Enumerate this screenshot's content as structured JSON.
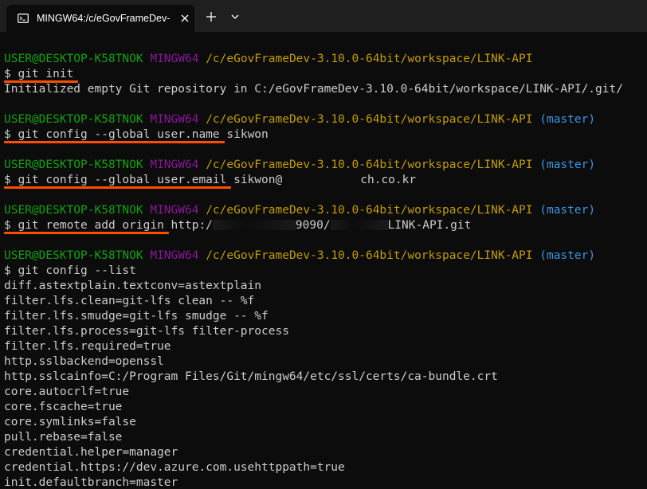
{
  "tab": {
    "title": "MINGW64:/c/eGovFrameDev-",
    "icon": "terminal-icon",
    "close_icon": "close-icon",
    "new_tab_icon": "plus-icon",
    "dropdown_icon": "chevron-down-icon"
  },
  "colors": {
    "user": "#13a10e",
    "shell": "#881798",
    "path": "#c19c00",
    "branch": "#3a96dd",
    "text": "#cccccc",
    "underline": "#ff4e00",
    "background": "#0c0c0c"
  },
  "prompt": {
    "user": "USER@DESKTOP-K58TNOK",
    "shell": "MINGW64",
    "path": "/c/eGovFrameDev-3.10.0-64bit/workspace/LINK-API",
    "branch": "(master)",
    "symbol": "$"
  },
  "commands": {
    "init": "git init",
    "init_output": "Initialized empty Git repository in C:/eGovFrameDev-3.10.0-64bit/workspace/LINK-API/.git/",
    "config_name": "git config --global user.name",
    "config_name_value": "sikwon",
    "config_email": "git config --global user.email",
    "config_email_prefix": "sikwon@",
    "config_email_suffix": "ch.co.kr",
    "remote_add": "git remote add origin",
    "remote_url_prefix": "http:/",
    "remote_url_mid": "9090/",
    "remote_url_suffix": "LINK-API.git",
    "config_list": "git config --list"
  },
  "config_list_output": [
    "diff.astextplain.textconv=astextplain",
    "filter.lfs.clean=git-lfs clean -- %f",
    "filter.lfs.smudge=git-lfs smudge -- %f",
    "filter.lfs.process=git-lfs filter-process",
    "filter.lfs.required=true",
    "http.sslbackend=openssl",
    "http.sslcainfo=C:/Program Files/Git/mingw64/etc/ssl/certs/ca-bundle.crt",
    "core.autocrlf=true",
    "core.fscache=true",
    "core.symlinks=false",
    "pull.rebase=false",
    "credential.helper=manager",
    "credential.https://dev.azure.com.usehttppath=true",
    "init.defaultbranch=master"
  ]
}
